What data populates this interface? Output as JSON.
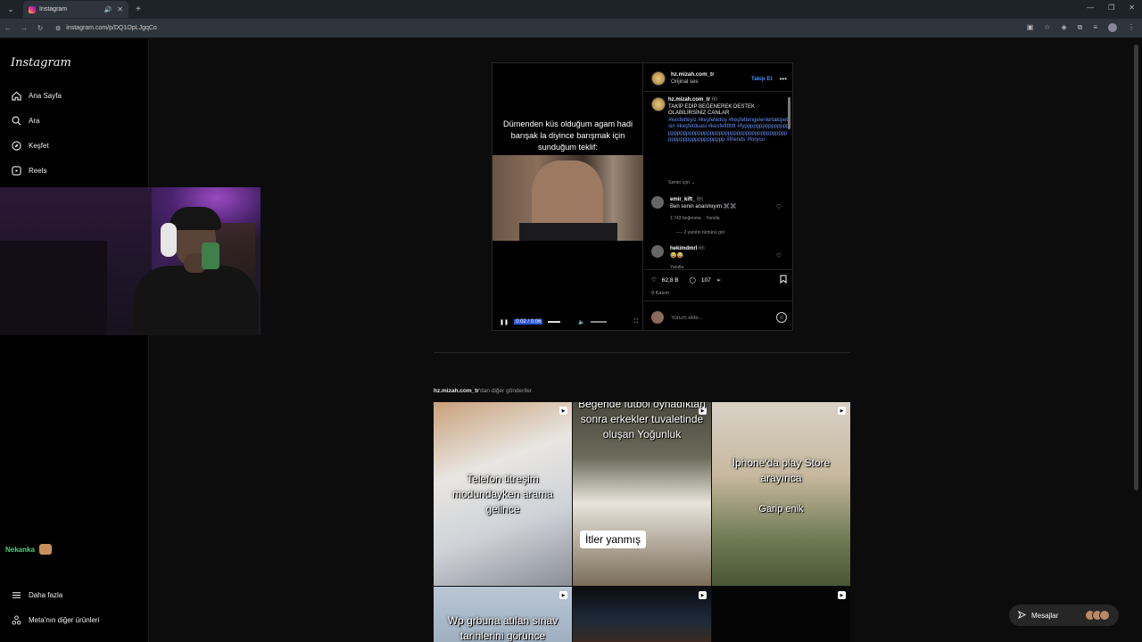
{
  "browser": {
    "tab_title": "Instagram",
    "new_tab": "+",
    "url": "instagram.com/p/DQ1OpLJgqCo"
  },
  "sidebar": {
    "logo": "Instagram",
    "items": [
      {
        "label": "Ana Sayfa",
        "icon": "home-icon"
      },
      {
        "label": "Ara",
        "icon": "search-icon"
      },
      {
        "label": "Keşfet",
        "icon": "compass-icon"
      },
      {
        "label": "Reels",
        "icon": "reels-icon"
      }
    ],
    "more": "Daha fazla",
    "meta": "Meta'nın diğer ürünleri"
  },
  "overlay": {
    "viewer_name": "Nekanka"
  },
  "post": {
    "video_text": "Dümenden küs olduğum agam hadi barışak la diyince barışmak için sunduğum teklif:",
    "video_time": "0:02 / 0:06",
    "username": "hz.mizah.com_tr",
    "audio": "Orijinal ses",
    "follow": "Takip Et",
    "caption_user": "hz.mizah.com_tr",
    "caption_time": "6h",
    "caption_text": "TAKİP EDİP BEĞENEREK DESTEK OLABİLİRSİNİZ CANLAR",
    "caption_tags": "#kesfetteyiz #keşfetedüş #keşfettengelenlertakipetsin #keşfetduasi #kesfetttttttt #fypppppppppppppppppppppppppppppppppppppppppppppppppppppppppppppppppppppppppp #friends #foryou",
    "for_you": "Senin için",
    "comments": [
      {
        "user": "emir_kift_",
        "time": "6h",
        "text": "Ben senin ananmıyım ✖️✖️",
        "likes": "1.743 beğenme",
        "reply": "Yanıtla",
        "view_replies": "2 yanıtın tümünü gör"
      },
      {
        "user": "hekimdmrl",
        "time": "6h",
        "text": "😂😂",
        "reply": "Yanıtla"
      }
    ],
    "likes": "62,8 B",
    "comment_count": "107",
    "date": "9 Kasım",
    "add_comment": "Yorum ekle..."
  },
  "more_posts": {
    "user": "hz.mizah.com_tr",
    "suffix": "'dan diğer gönderiler",
    "items": [
      {
        "text": "Telefon titreşim modundayken arama gelince"
      },
      {
        "text": "Beğende futbol oynadıktan sonra erkekler tuvaletinde oluşan Yoğunluk",
        "label": "İtler yanmış"
      },
      {
        "text": "İphone'da play Store arayınca",
        "sub": "Garip enik"
      },
      {
        "text": "Wp grbuna atılan sınav tarihlerini görünce"
      }
    ]
  },
  "messages": {
    "label": "Mesajlar"
  }
}
